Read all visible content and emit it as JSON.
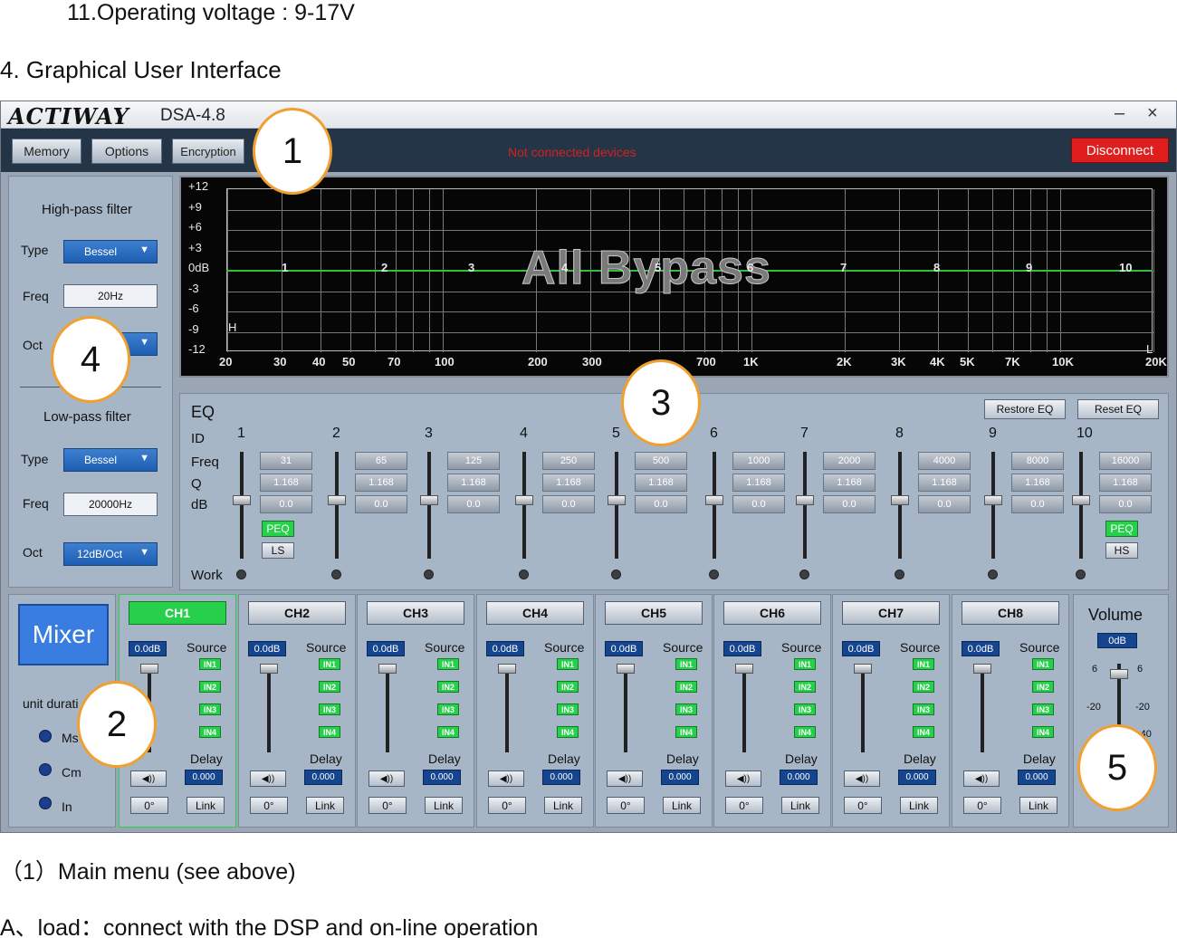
{
  "doc": {
    "spec_item": "11.Operating voltage : 9-17V",
    "section": "4. Graphical User Interface",
    "caption": "（1）Main menu (see above)",
    "note": "A、load：connect with the DSP and on-line operation"
  },
  "window": {
    "logo": "ACTIWAY",
    "title": "DSA-4.8",
    "minimize": "–",
    "close": "×"
  },
  "menu": {
    "memory": "Memory",
    "options": "Options",
    "encryption": "Encryption",
    "status": "Not connected devices",
    "disconnect": "Disconnect"
  },
  "filters": {
    "hp_title": "High-pass filter",
    "hp_type_label": "Type",
    "hp_type": "Bessel",
    "hp_freq_label": "Freq",
    "hp_freq": "20Hz",
    "hp_oct_label": "Oct",
    "lp_title": "Low-pass filter",
    "lp_type_label": "Type",
    "lp_type": "Bessel",
    "lp_freq_label": "Freq",
    "lp_freq": "20000Hz",
    "lp_oct_label": "Oct",
    "lp_oct": "12dB/Oct"
  },
  "graph": {
    "overlay": "All Bypass",
    "y_ticks": [
      "+12",
      "+9",
      "+6",
      "+3",
      "0dB",
      "-3",
      "-6",
      "-9",
      "-12"
    ],
    "x_ticks": [
      "20",
      "30",
      "40",
      "50",
      "70",
      "100",
      "200",
      "300",
      "700",
      "1K",
      "2K",
      "3K",
      "4K",
      "5K",
      "7K",
      "10K",
      "20K"
    ],
    "band_markers": [
      "1",
      "2",
      "3",
      "4",
      "5",
      "6",
      "7",
      "8",
      "9",
      "10"
    ],
    "hp_marker": "H",
    "lp_marker": "L"
  },
  "eq": {
    "title": "EQ",
    "restore": "Restore EQ",
    "reset": "Reset EQ",
    "row_labels": [
      "ID",
      "Freq",
      "Q",
      "dB",
      "Work"
    ],
    "bands": [
      {
        "id": "1",
        "freq": "31",
        "q": "1.168",
        "db": "0.0"
      },
      {
        "id": "2",
        "freq": "65",
        "q": "1.168",
        "db": "0.0"
      },
      {
        "id": "3",
        "freq": "125",
        "q": "1.168",
        "db": "0.0"
      },
      {
        "id": "4",
        "freq": "250",
        "q": "1.168",
        "db": "0.0"
      },
      {
        "id": "5",
        "freq": "500",
        "q": "1.168",
        "db": "0.0"
      },
      {
        "id": "6",
        "freq": "1000",
        "q": "1.168",
        "db": "0.0"
      },
      {
        "id": "7",
        "freq": "2000",
        "q": "1.168",
        "db": "0.0"
      },
      {
        "id": "8",
        "freq": "4000",
        "q": "1.168",
        "db": "0.0"
      },
      {
        "id": "9",
        "freq": "8000",
        "q": "1.168",
        "db": "0.0"
      },
      {
        "id": "10",
        "freq": "16000",
        "q": "1.168",
        "db": "0.0"
      }
    ],
    "peq": "PEQ",
    "ls": "LS",
    "hs": "HS"
  },
  "mixer": {
    "button": "Mixer",
    "unit_label": "unit durati",
    "units": [
      "Ms",
      "Cm",
      "In"
    ],
    "source_label": "Source",
    "delay_label": "Delay",
    "inputs": [
      "IN1",
      "IN2",
      "IN3",
      "IN4"
    ],
    "phase": "0°",
    "link": "Link",
    "speaker": "◀))",
    "channels": [
      {
        "name": "CH1",
        "gain": "0.0dB",
        "delay": "0.000"
      },
      {
        "name": "CH2",
        "gain": "0.0dB",
        "delay": "0.000"
      },
      {
        "name": "CH3",
        "gain": "0.0dB",
        "delay": "0.000"
      },
      {
        "name": "CH4",
        "gain": "0.0dB",
        "delay": "0.000"
      },
      {
        "name": "CH5",
        "gain": "0.0dB",
        "delay": "0.000"
      },
      {
        "name": "CH6",
        "gain": "0.0dB",
        "delay": "0.000"
      },
      {
        "name": "CH7",
        "gain": "0.0dB",
        "delay": "0.000"
      },
      {
        "name": "CH8",
        "gain": "0.0dB",
        "delay": "0.000"
      }
    ]
  },
  "volume": {
    "title": "Volume",
    "value": "0dB",
    "scale_left": [
      "6",
      "-20"
    ],
    "scale_right": [
      "6",
      "-20",
      "-40"
    ]
  },
  "markers": [
    "1",
    "2",
    "3",
    "4",
    "5"
  ],
  "colors": {
    "active_green": "#27d04a",
    "disconnect_red": "#e01e1e",
    "menubar": "#243548",
    "panel": "#a7b6c7",
    "marker_ring": "#f0a030"
  }
}
